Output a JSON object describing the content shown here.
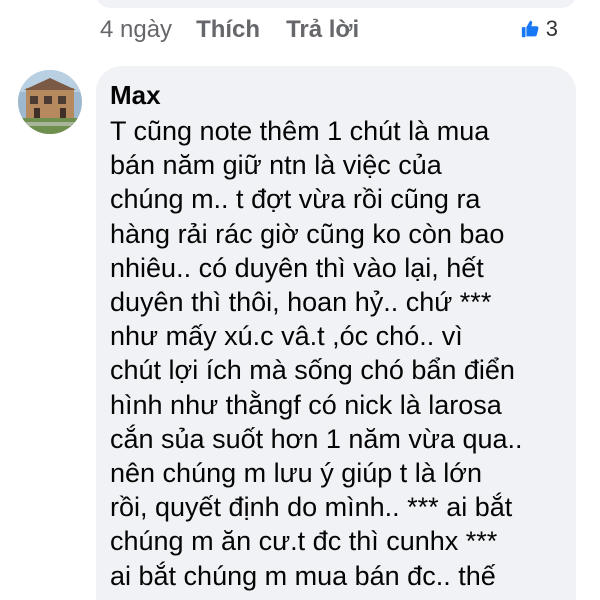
{
  "previous_comment": {
    "time": "4 ngày",
    "like_label": "Thích",
    "reply_label": "Trả lời",
    "reaction": {
      "icon": "thumbs-up-icon",
      "count": "3",
      "color": "#1877f2"
    }
  },
  "comment": {
    "author": "Max",
    "avatar": "house-photo",
    "lines": [
      "T cũng note thêm 1 chút là mua",
      "bán năm giữ ntn là việc của",
      "chúng m.. t đợt vừa rồi cũng ra",
      "hàng rải rác giờ cũng ko còn bao",
      "nhiêu.. có duyên thì vào lại, hết",
      "duyên thì thôi, hoan hỷ.. chứ ***",
      "như mấy xú.c vâ.t ,óc chó.. vì",
      "chút lợi ích mà sống chó bẩn điển",
      "hình như thằngf có nick là larosa",
      "cắn sủa suốt hơn 1 năm vừa qua..",
      "nên chúng m lưu ý giúp t là lớn",
      "rồi, quyết định do mình.. *** ai bắt",
      "chúng m ăn cư.t đc thì cunhx ***",
      "ai bắt chúng m mua bán đc.. thế"
    ]
  },
  "colors": {
    "bubble": "#f0f2f5",
    "meta_text": "#65676b",
    "text": "#050505",
    "accent": "#1877f2"
  }
}
